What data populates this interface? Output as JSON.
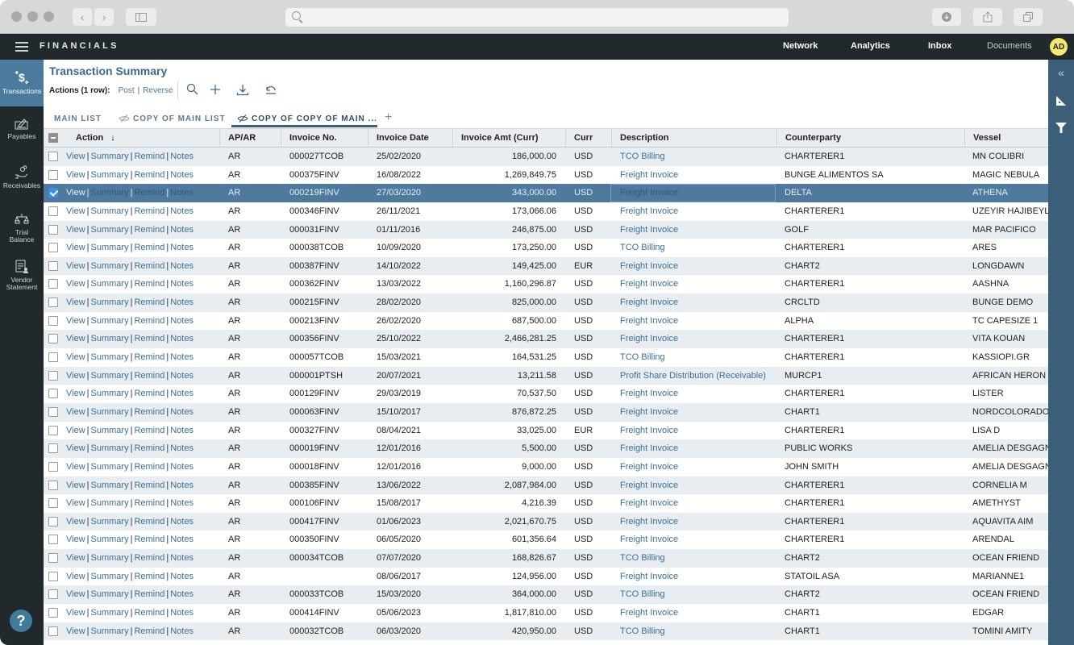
{
  "browser": {
    "url": ""
  },
  "app": {
    "brand": "FINANCIALS",
    "nav": [
      {
        "label": "Network"
      },
      {
        "label": "Analytics"
      },
      {
        "label": "Inbox"
      },
      {
        "label": "Documents"
      }
    ],
    "avatar_initials": "AD"
  },
  "sidebar": {
    "items": [
      {
        "label": "Transactions",
        "icon": "dollar-transfer-icon",
        "active": true
      },
      {
        "label": "Payables",
        "icon": "check-signing-icon"
      },
      {
        "label": "Receivables",
        "icon": "hand-coins-icon"
      },
      {
        "label": "Trial Balance",
        "icon": "scales-icon"
      },
      {
        "label": "Vendor Statement",
        "icon": "statement-person-icon"
      }
    ],
    "help_label": "?"
  },
  "page": {
    "title": "Transaction Summary",
    "actions_label": "Actions (1 row):",
    "action_links": [
      "Post",
      "Reverse"
    ],
    "tabs": [
      {
        "label": "MAIN LIST",
        "hidden_icon": false
      },
      {
        "label": "COPY OF MAIN LIST",
        "hidden_icon": true
      },
      {
        "label": "COPY OF COPY OF MAIN ...",
        "hidden_icon": true,
        "active": true
      }
    ],
    "add_tab": "+"
  },
  "grid": {
    "columns": [
      "Action",
      "AP/AR",
      "Invoice No.",
      "Invoice Date",
      "Invoice Amt (Curr)",
      "Curr",
      "Description",
      "Counterparty",
      "Vessel"
    ],
    "sort_column": "Action",
    "sort_direction": "descending",
    "row_actions": [
      "View",
      "Summary",
      "Remind",
      "Notes"
    ],
    "rows": [
      {
        "apar": "AR",
        "invoice_no": "000027TCOB",
        "date": "25/02/2020",
        "amount": "186,000.00",
        "curr": "USD",
        "description": "TCO Billing",
        "counterparty": "CHARTERER1",
        "vessel": "MN COLIBRI",
        "selected": false
      },
      {
        "apar": "AR",
        "invoice_no": "000375FINV",
        "date": "16/08/2022",
        "amount": "1,269,849.75",
        "curr": "USD",
        "description": "Freight Invoice",
        "counterparty": "BUNGE ALIMENTOS SA",
        "vessel": "MAGIC NEBULA",
        "selected": false
      },
      {
        "apar": "AR",
        "invoice_no": "000219FINV",
        "date": "27/03/2020",
        "amount": "343,000.00",
        "curr": "USD",
        "description": "Freight Invoice",
        "counterparty": "DELTA",
        "vessel": "ATHENA",
        "selected": true
      },
      {
        "apar": "AR",
        "invoice_no": "000346FINV",
        "date": "26/11/2021",
        "amount": "173,066.06",
        "curr": "USD",
        "description": "Freight Invoice",
        "counterparty": "CHARTERER1",
        "vessel": "UZEYIR HAJIBEYLI",
        "selected": false
      },
      {
        "apar": "AR",
        "invoice_no": "000031FINV",
        "date": "01/11/2016",
        "amount": "246,875.00",
        "curr": "USD",
        "description": "Freight Invoice",
        "counterparty": "GOLF",
        "vessel": "MAR PACIFICO",
        "selected": false
      },
      {
        "apar": "AR",
        "invoice_no": "000038TCOB",
        "date": "10/09/2020",
        "amount": "173,250.00",
        "curr": "USD",
        "description": "TCO Billing",
        "counterparty": "CHARTERER1",
        "vessel": "ARES",
        "selected": false
      },
      {
        "apar": "AR",
        "invoice_no": "000387FINV",
        "date": "14/10/2022",
        "amount": "149,425.00",
        "curr": "EUR",
        "description": "Freight Invoice",
        "counterparty": "CHART2",
        "vessel": "LONGDAWN",
        "selected": false
      },
      {
        "apar": "AR",
        "invoice_no": "000362FINV",
        "date": "13/03/2022",
        "amount": "1,160,296.87",
        "curr": "USD",
        "description": "Freight Invoice",
        "counterparty": "CHARTERER1",
        "vessel": "AASHNA",
        "selected": false
      },
      {
        "apar": "AR",
        "invoice_no": "000215FINV",
        "date": "28/02/2020",
        "amount": "825,000.00",
        "curr": "USD",
        "description": "Freight Invoice",
        "counterparty": "CRCLTD",
        "vessel": "BUNGE DEMO",
        "selected": false
      },
      {
        "apar": "AR",
        "invoice_no": "000213FINV",
        "date": "26/02/2020",
        "amount": "687,500.00",
        "curr": "USD",
        "description": "Freight Invoice",
        "counterparty": "ALPHA",
        "vessel": "TC CAPESIZE 1",
        "selected": false
      },
      {
        "apar": "AR",
        "invoice_no": "000356FINV",
        "date": "25/10/2022",
        "amount": "2,466,281.25",
        "curr": "USD",
        "description": "Freight Invoice",
        "counterparty": "CHARTERER1",
        "vessel": "VITA KOUAN",
        "selected": false
      },
      {
        "apar": "AR",
        "invoice_no": "000057TCOB",
        "date": "15/03/2021",
        "amount": "164,531.25",
        "curr": "USD",
        "description": "TCO Billing",
        "counterparty": "CHARTERER1",
        "vessel": "KASSIOPI.GR",
        "selected": false
      },
      {
        "apar": "AR",
        "invoice_no": "000001PTSH",
        "date": "20/07/2021",
        "amount": "13,211.58",
        "curr": "USD",
        "description": "Profit Share Distribution (Receivable)",
        "counterparty": "MURCP1",
        "vessel": "AFRICAN HERON",
        "selected": false
      },
      {
        "apar": "AR",
        "invoice_no": "000129FINV",
        "date": "29/03/2019",
        "amount": "70,537.50",
        "curr": "USD",
        "description": "Freight Invoice",
        "counterparty": "CHARTERER1",
        "vessel": "LISTER",
        "selected": false
      },
      {
        "apar": "AR",
        "invoice_no": "000063FINV",
        "date": "15/10/2017",
        "amount": "876,872.25",
        "curr": "USD",
        "description": "Freight Invoice",
        "counterparty": "CHART1",
        "vessel": "NORDCOLORADO",
        "selected": false
      },
      {
        "apar": "AR",
        "invoice_no": "000327FINV",
        "date": "08/04/2021",
        "amount": "33,025.00",
        "curr": "EUR",
        "description": "Freight Invoice",
        "counterparty": "CHARTERER1",
        "vessel": "LISA D",
        "selected": false
      },
      {
        "apar": "AR",
        "invoice_no": "000019FINV",
        "date": "12/01/2016",
        "amount": "5,500.00",
        "curr": "USD",
        "description": "Freight Invoice",
        "counterparty": "PUBLIC WORKS",
        "vessel": "AMELIA DESGAGNES",
        "selected": false
      },
      {
        "apar": "AR",
        "invoice_no": "000018FINV",
        "date": "12/01/2016",
        "amount": "9,000.00",
        "curr": "USD",
        "description": "Freight Invoice",
        "counterparty": "JOHN SMITH",
        "vessel": "AMELIA DESGAGNES",
        "selected": false
      },
      {
        "apar": "AR",
        "invoice_no": "000385FINV",
        "date": "13/06/2022",
        "amount": "2,087,984.00",
        "curr": "USD",
        "description": "Freight Invoice",
        "counterparty": "CHARTERER1",
        "vessel": "CORNELIA M",
        "selected": false
      },
      {
        "apar": "AR",
        "invoice_no": "000106FINV",
        "date": "15/08/2017",
        "amount": "4,216.39",
        "curr": "USD",
        "description": "Freight Invoice",
        "counterparty": "CHARTERER1",
        "vessel": "AMETHYST",
        "selected": false
      },
      {
        "apar": "AR",
        "invoice_no": "000417FINV",
        "date": "01/06/2023",
        "amount": "2,021,670.75",
        "curr": "USD",
        "description": "Freight Invoice",
        "counterparty": "CHARTERER1",
        "vessel": "AQUAVITA AIM",
        "selected": false
      },
      {
        "apar": "AR",
        "invoice_no": "000350FINV",
        "date": "06/05/2020",
        "amount": "601,356.64",
        "curr": "USD",
        "description": "Freight Invoice",
        "counterparty": "CHARTERER1",
        "vessel": "ARENDAL",
        "selected": false
      },
      {
        "apar": "AR",
        "invoice_no": "000034TCOB",
        "date": "07/07/2020",
        "amount": "168,826.67",
        "curr": "USD",
        "description": "TCO Billing",
        "counterparty": "CHART2",
        "vessel": "OCEAN FRIEND",
        "selected": false
      },
      {
        "apar": "AR",
        "invoice_no": "",
        "date": "08/06/2017",
        "amount": "124,956.00",
        "curr": "USD",
        "description": "Freight Invoice",
        "counterparty": "STATOIL ASA",
        "vessel": "MARIANNE1",
        "selected": false
      },
      {
        "apar": "AR",
        "invoice_no": "000033TCOB",
        "date": "15/03/2020",
        "amount": "364,000.00",
        "curr": "USD",
        "description": "TCO Billing",
        "counterparty": "CHART2",
        "vessel": "OCEAN FRIEND",
        "selected": false
      },
      {
        "apar": "AR",
        "invoice_no": "000414FINV",
        "date": "05/06/2023",
        "amount": "1,817,810.00",
        "curr": "USD",
        "description": "Freight Invoice",
        "counterparty": "CHART1",
        "vessel": "EDGAR",
        "selected": false
      },
      {
        "apar": "AR",
        "invoice_no": "000032TCOB",
        "date": "06/03/2020",
        "amount": "420,950.00",
        "curr": "USD",
        "description": "TCO Billing",
        "counterparty": "CHART1",
        "vessel": "TOMINI AMITY",
        "selected": false
      }
    ]
  },
  "colors": {
    "accent": "#3b6a8d",
    "topbar": "#22292d",
    "selected_row": "#4f7a9d",
    "alt_row": "#e8edf2",
    "link": "#3e6f92",
    "avatar": "#f3e96a"
  }
}
